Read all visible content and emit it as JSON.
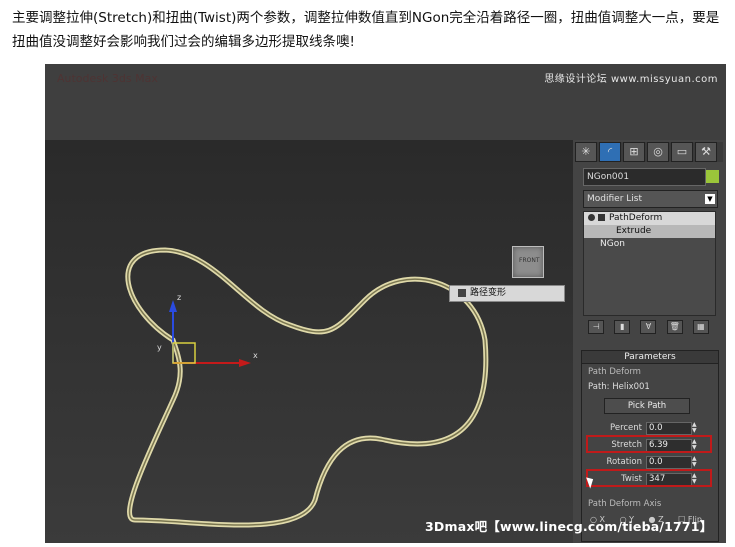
{
  "intro": {
    "text": "主要调整拉伸(Stretch)和扭曲(Twist)两个参数，调整拉伸数值直到NGon完全沿着路径一圈，扭曲值调整大一点，要是扭曲值没调整好会影响我们过会的编辑多边形提取线条噢!"
  },
  "screenshot": {
    "brand": "思缘设计论坛 www.missyuan.com",
    "watermark": "3Dmax吧【www.linecg.com/tieba/1771】",
    "viewport": {
      "modifier_label": "路径变形",
      "axis_x": "x",
      "axis_y": "y",
      "axis_z": "z"
    },
    "command_panel": {
      "tabs": [
        "create-icon",
        "modify-icon",
        "hierarchy-icon",
        "motion-icon",
        "display-icon",
        "utilities-icon"
      ],
      "object_name": "NGon001",
      "object_color": "#9bc63a",
      "modifier_list": "Modifier List",
      "stack": [
        "PathDeform",
        "Extrude",
        "NGon"
      ],
      "parameters": {
        "title": "Parameters",
        "group_path_deform": "Path Deform",
        "path_label": "Path: Helix001",
        "pick_path": "Pick Path",
        "percent_label": "Percent",
        "percent_value": "0.0",
        "stretch_label": "Stretch",
        "stretch_value": "6.39",
        "rotation_label": "Rotation",
        "rotation_value": "0.0",
        "twist_label": "Twist",
        "twist_value": "347",
        "axis_group": "Path Deform Axis",
        "axis_x": "X",
        "axis_y": "Y",
        "axis_z": "Z",
        "flip": "Flip"
      }
    }
  }
}
